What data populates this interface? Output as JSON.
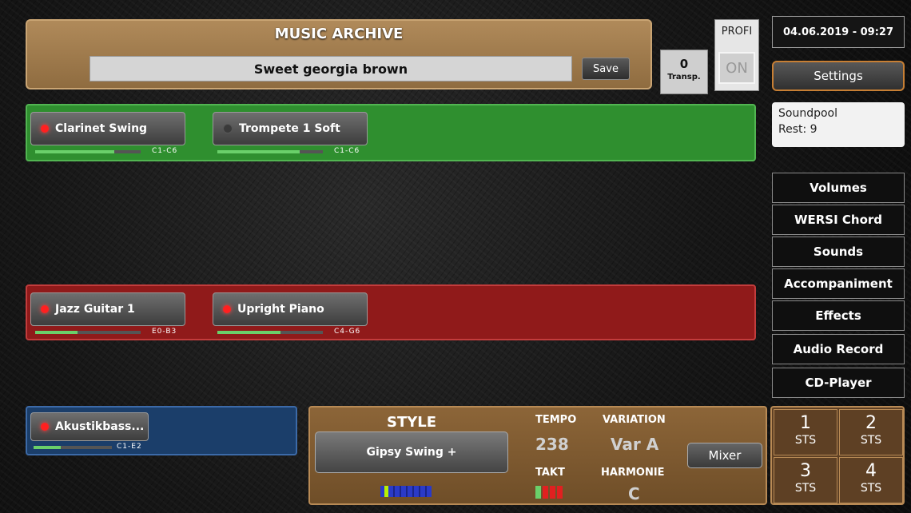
{
  "archive": {
    "title": "MUSIC ARCHIVE",
    "song": "Sweet georgia brown",
    "save_label": "Save"
  },
  "transpose": {
    "value": "0",
    "label": "Transp."
  },
  "profi": {
    "label": "PROFI",
    "state": "ON"
  },
  "datetime": "04.06.2019 - 09:27",
  "settings_label": "Settings",
  "soundpool": {
    "line1": "Soundpool",
    "line2": "Rest: 9"
  },
  "voices_upper": [
    {
      "name": "Clarinet Swing",
      "active": true,
      "range": "C1-C6",
      "volume": 0.75
    },
    {
      "name": "Trompete 1 Soft",
      "active": false,
      "range": "C1-C6",
      "volume": 0.78
    }
  ],
  "voices_lower": [
    {
      "name": "Jazz Guitar 1",
      "active": true,
      "range": "E0-B3",
      "volume": 0.4
    },
    {
      "name": "Upright Piano",
      "active": true,
      "range": "C4-G6",
      "volume": 0.6
    }
  ],
  "voices_bass": [
    {
      "name": "Akustikbass...",
      "active": true,
      "range": "C1-E2",
      "volume": 0.35
    }
  ],
  "menu": [
    "Volumes",
    "WERSI Chord",
    "Sounds",
    "Accompaniment",
    "Effects",
    "Audio Record",
    "CD-Player"
  ],
  "style": {
    "title": "STYLE",
    "name": "Gipsy Swing +",
    "tempo_label": "TEMPO",
    "tempo": "238",
    "takt_label": "TAKT",
    "variation_label": "VARIATION",
    "variation": "Var A",
    "harmonie_label": "HARMONIE",
    "harmonie": "C",
    "mixer_label": "Mixer"
  },
  "sts": [
    {
      "num": "1",
      "label": "STS"
    },
    {
      "num": "2",
      "label": "STS"
    },
    {
      "num": "3",
      "label": "STS"
    },
    {
      "num": "4",
      "label": "STS"
    }
  ],
  "colors": {
    "upper_bar": "#2f8f2f",
    "lower_bar": "#901a1a",
    "bass_bar": "#1b3e6a",
    "style_panel": "#8c6538",
    "led_on": "#ff2020",
    "accent": "#c77f34"
  }
}
